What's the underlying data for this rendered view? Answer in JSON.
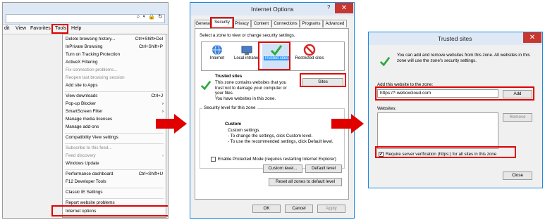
{
  "panel1": {
    "menubar": [
      "dit",
      "View",
      "Favorites",
      "Tools",
      "Help"
    ],
    "address_icons": "⌕ ▾ 🔒 ↻",
    "menu_items": [
      {
        "label": "Delete browsing history...",
        "shortcut": "Ctrl+Shift+Del",
        "disabled": false
      },
      {
        "label": "InPrivate Browsing",
        "shortcut": "Ctrl+Shift+P",
        "disabled": false
      },
      {
        "label": "Turn on Tracking Protection",
        "shortcut": "",
        "disabled": false
      },
      {
        "label": "ActiveX Filtering",
        "shortcut": "",
        "disabled": false
      },
      {
        "label": "Fix connection problems...",
        "shortcut": "",
        "disabled": true
      },
      {
        "label": "Reopen last browsing session",
        "shortcut": "",
        "disabled": true
      },
      {
        "label": "Add site to Apps",
        "shortcut": "",
        "disabled": false
      },
      {
        "label": "View downloads",
        "shortcut": "Ctrl+J",
        "disabled": false
      },
      {
        "label": "Pop-up Blocker",
        "shortcut": "›",
        "disabled": false
      },
      {
        "label": "SmartScreen Filter",
        "shortcut": "›",
        "disabled": false
      },
      {
        "label": "Manage media licenses",
        "shortcut": "",
        "disabled": false
      },
      {
        "label": "Manage add-ons",
        "shortcut": "",
        "disabled": false
      },
      {
        "label": "Compatibility View settings",
        "shortcut": "",
        "disabled": false
      },
      {
        "label": "Subscribe to this feed...",
        "shortcut": "",
        "disabled": true
      },
      {
        "label": "Feed discovery",
        "shortcut": "›",
        "disabled": true
      },
      {
        "label": "Windows Update",
        "shortcut": "",
        "disabled": false
      },
      {
        "label": "Performance dashboard",
        "shortcut": "Ctrl+Shift+U",
        "disabled": false
      },
      {
        "label": "F12 Developer Tools",
        "shortcut": "",
        "disabled": false
      },
      {
        "label": "Classic IE Settings",
        "shortcut": "",
        "disabled": false
      },
      {
        "label": "Report website problems",
        "shortcut": "",
        "disabled": false
      },
      {
        "label": "Internet options",
        "shortcut": "",
        "disabled": false
      }
    ]
  },
  "panel2": {
    "title": "Internet Options",
    "help": "?",
    "close": "✕",
    "tabs": [
      "General",
      "Security",
      "Privacy",
      "Content",
      "Connections",
      "Programs",
      "Advanced"
    ],
    "select_zone_text": "Select a zone to view or change security settings.",
    "zones": [
      "Internet",
      "Local intranet",
      "Trusted sites",
      "Restricted sites"
    ],
    "zone_title": "Trusted sites",
    "zone_desc": "This zone contains websites that you trust not to damage your computer or your files.",
    "zone_has_sites": "You have websites in this zone.",
    "sites_button": "Sites",
    "security_level_label": "Security level for this zone",
    "custom_title": "Custom",
    "custom_lines": [
      "Custom settings.",
      "- To change the settings, click Custom level.",
      "- To use the recommended settings, click Default level."
    ],
    "protected_mode": "Enable Protected Mode (requires restarting Internet Explorer)",
    "custom_level_button": "Custom level...",
    "default_level_button": "Default level",
    "reset_button": "Reset all zones to default level",
    "ok": "OK",
    "cancel": "Cancel",
    "apply": "Apply"
  },
  "panel3": {
    "title": "Trusted sites",
    "close": "✕",
    "info": "You can add and remove websites from this zone. All websites in this zone will use the zone's security settings.",
    "add_label": "Add this website to the zone:",
    "url_value": "https://*.weboxcloud.com",
    "add_button": "Add",
    "websites_label": "Websites:",
    "remove_button": "Remove",
    "require_verification": "Require server verification (https:) for all sites in this zone",
    "close_button": "Close"
  },
  "colors": {
    "highlight": "#e00000",
    "accent": "#1c8ae0",
    "check_green": "#2eaa3a"
  }
}
